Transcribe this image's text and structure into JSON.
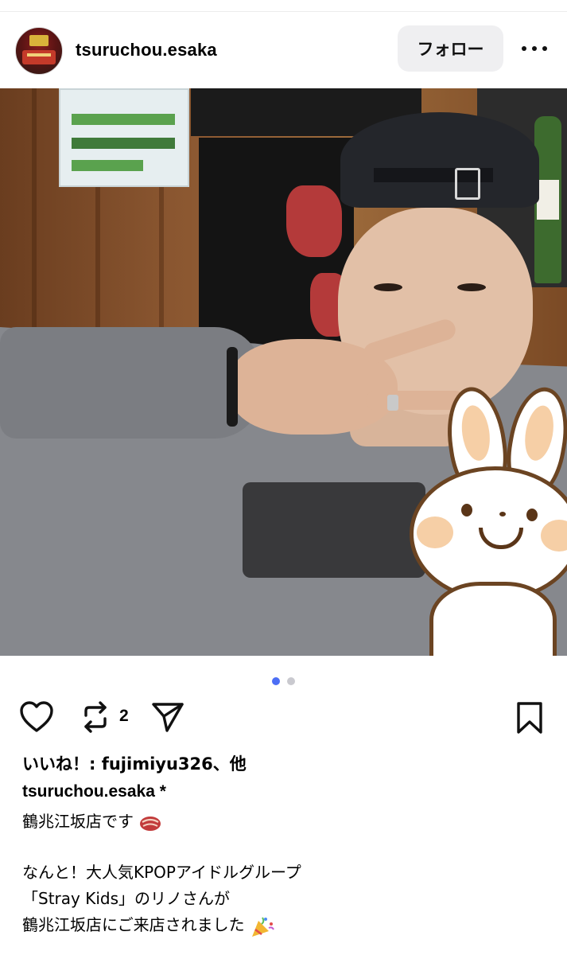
{
  "post": {
    "username": "tsuruchou.esaka",
    "follow_label": "フォロー",
    "image_count": 2,
    "active_image": 1,
    "repost_count": "2",
    "likes_text": "いいね！: fujimiyu326、他",
    "caption_user": "tsuruchou.esaka *",
    "caption_lines": [
      "鶴兆江坂店です",
      "",
      "なんと！大人気KPOPアイドルグループ",
      "「Stray Kids」のリノさんが",
      "鶴兆江坂店にご来店されました"
    ]
  },
  "colors": {
    "pager_active": "#4c6ef5",
    "pager_inactive": "#c9c9cf",
    "follow_bg": "#efeff1"
  },
  "icons": [
    "more-icon",
    "heart-icon",
    "repost-icon",
    "send-icon",
    "bookmark-icon",
    "meat-emoji",
    "party-popper-emoji"
  ]
}
